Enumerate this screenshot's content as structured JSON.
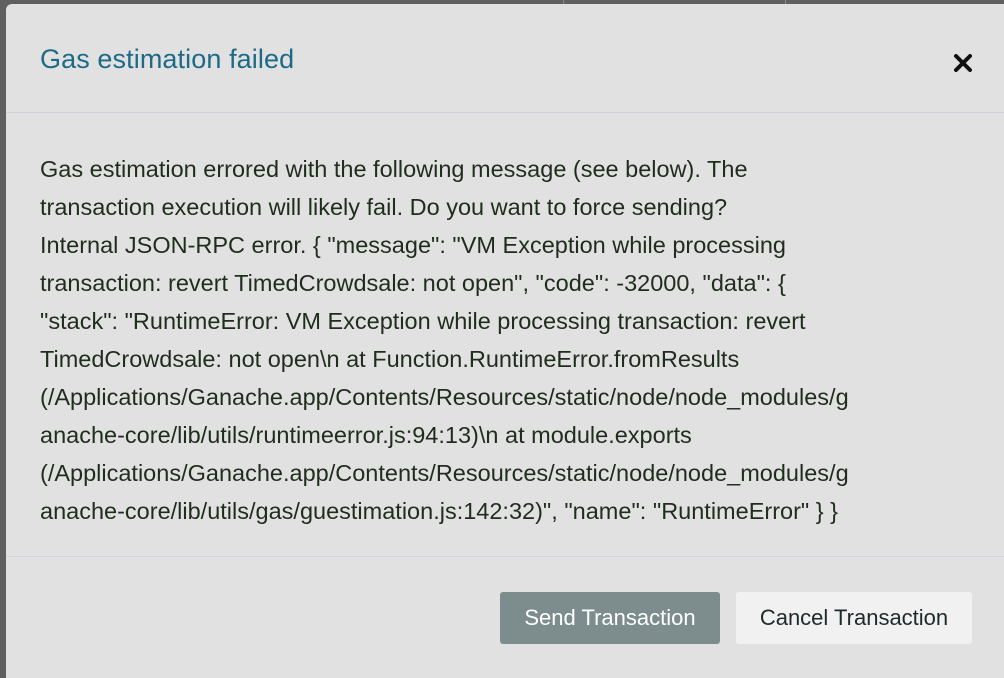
{
  "dialog": {
    "title": "Gas estimation failed",
    "close_icon": "close-icon",
    "message_lines": [
      "Gas estimation errored with the following message (see below). The",
      "transaction execution will likely fail. Do you want to force sending?",
      "Internal JSON-RPC error. { \"message\": \"VM Exception while processing",
      "transaction: revert TimedCrowdsale: not open\", \"code\": -32000, \"data\": {",
      "\"stack\": \"RuntimeError: VM Exception while processing transaction: revert",
      "TimedCrowdsale: not open\\n at Function.RuntimeError.fromResults",
      "(/Applications/Ganache.app/Contents/Resources/static/node/node_modules/g",
      "anache-core/lib/utils/runtimeerror.js:94:13)\\n at module.exports",
      "(/Applications/Ganache.app/Contents/Resources/static/node/node_modules/g",
      "anache-core/lib/utils/gas/guestimation.js:142:32)\", \"name\": \"RuntimeError\" } }"
    ],
    "buttons": {
      "send": "Send Transaction",
      "cancel": "Cancel Transaction"
    }
  },
  "colors": {
    "title": "#1d6a87",
    "body_text": "#1f2d1c",
    "dialog_bg": "#e1e1e1",
    "send_button_bg": "#7d8c8c",
    "cancel_button_bg": "#f1f1f1"
  }
}
